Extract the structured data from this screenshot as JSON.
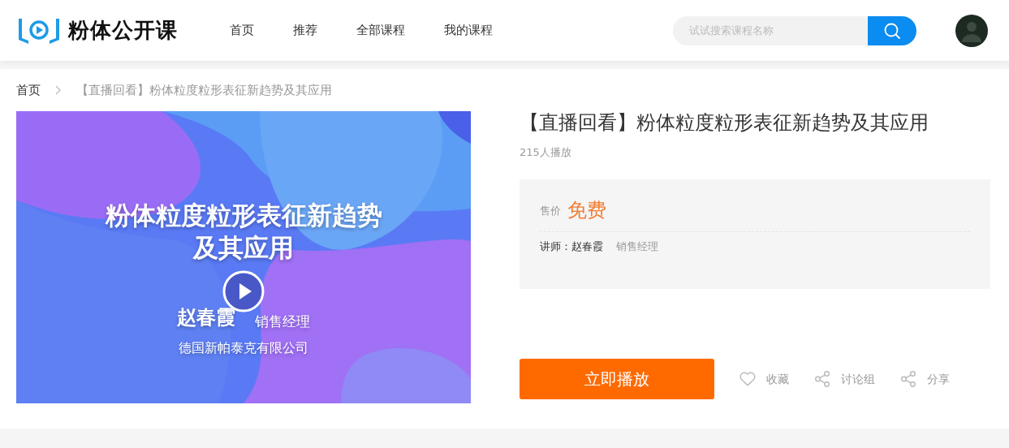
{
  "header": {
    "logo_text": "粉体公开课",
    "nav": [
      {
        "label": "首页",
        "selected": false
      },
      {
        "label": "推荐",
        "selected": false
      },
      {
        "label": "全部课程",
        "selected": false
      },
      {
        "label": "我的课程",
        "selected": false
      }
    ],
    "search": {
      "placeholder": "试试搜索课程名称"
    }
  },
  "breadcrumb": [
    {
      "label": "首页"
    },
    {
      "label": "【直播回看】粉体粒度粒形表征新趋势及其应用"
    }
  ],
  "cover": {
    "title_lines": [
      "粉体粒度粒形表征新趋势",
      "及其应用"
    ],
    "speaker": "赵春霞",
    "role": "销售经理",
    "company": "德国新帕泰克有限公司"
  },
  "course": {
    "title": "【直播回看】粉体粒度粒形表征新趋势及其应用",
    "plays": "215人播放",
    "price_label": "售价",
    "price": "免费",
    "lecturer_label": "讲师：",
    "lecturer": "赵春霞",
    "lecturer_role": "销售经理"
  },
  "actions": {
    "play_button": "立即播放",
    "links": [
      {
        "kind": "heart",
        "label": "收藏"
      },
      {
        "kind": "share",
        "label": "讨论组"
      },
      {
        "kind": "share",
        "label": "分享"
      }
    ]
  }
}
